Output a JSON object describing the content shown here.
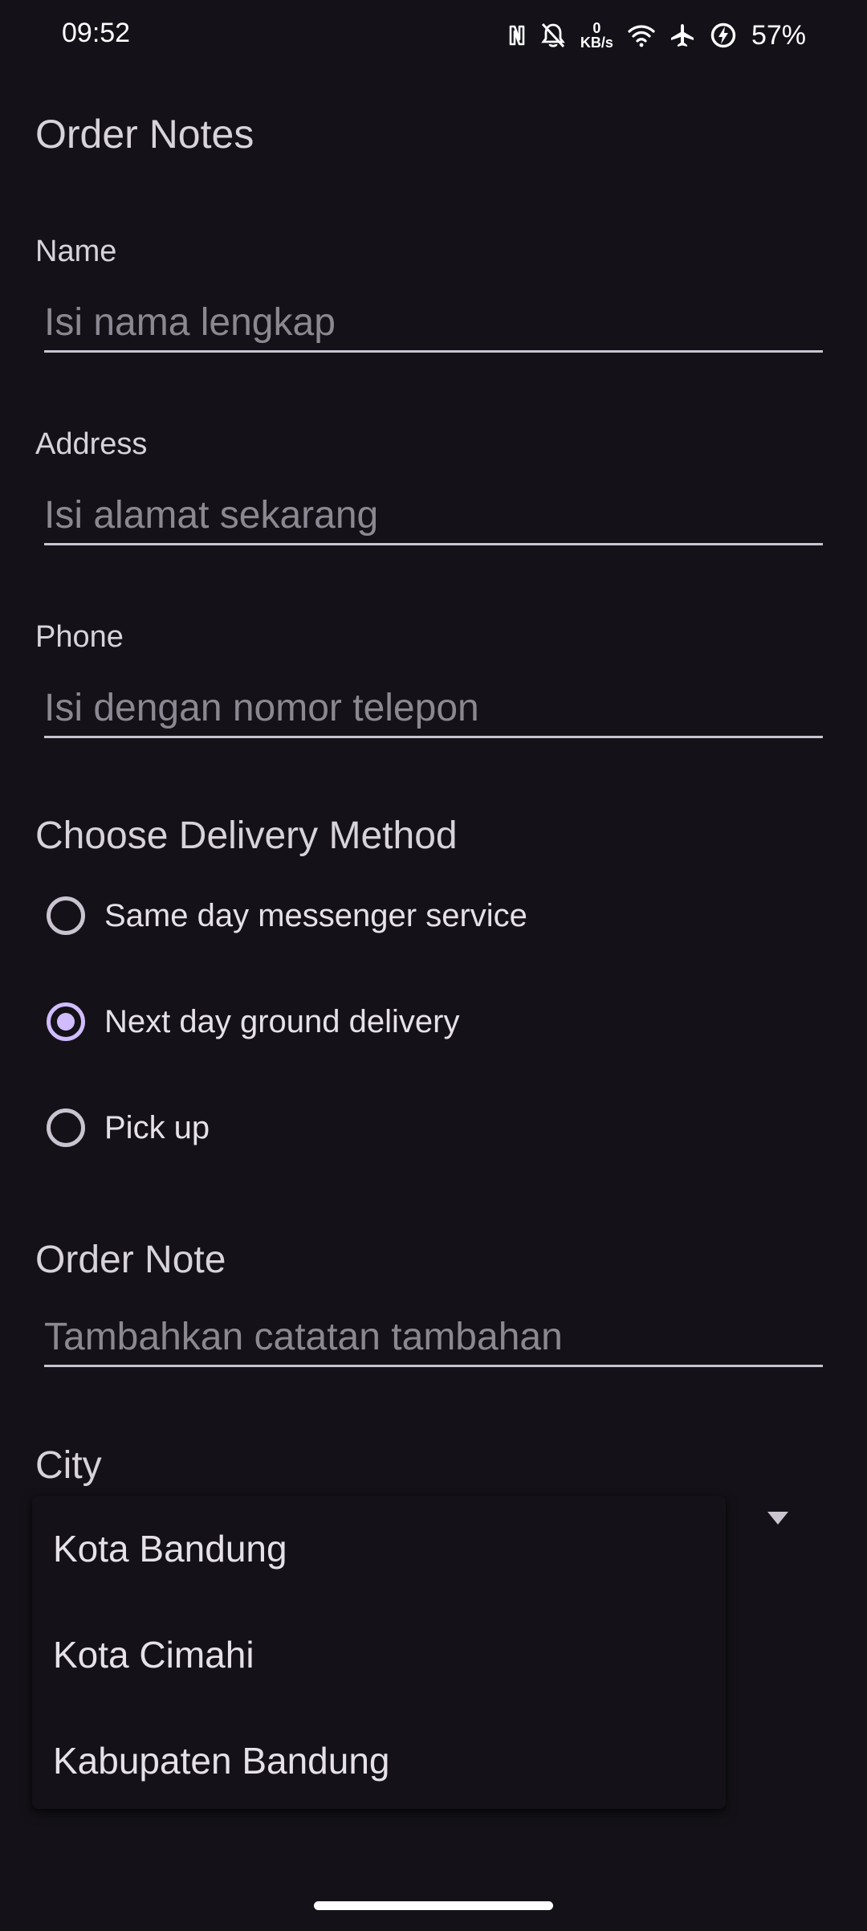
{
  "status_bar": {
    "time": "09:52",
    "net_speed_value": "0",
    "net_speed_unit": "KB/s",
    "battery": "57%",
    "icons": [
      "nfc-icon",
      "bell-off-icon",
      "wifi-icon",
      "airplane-icon",
      "battery-saver-icon"
    ]
  },
  "page": {
    "title": "Order Notes"
  },
  "form": {
    "name": {
      "label": "Name",
      "placeholder": "Isi nama lengkap",
      "value": ""
    },
    "address": {
      "label": "Address",
      "placeholder": "Isi alamat sekarang",
      "value": ""
    },
    "phone": {
      "label": "Phone",
      "placeholder": "Isi dengan nomor telepon",
      "value": ""
    }
  },
  "delivery": {
    "title": "Choose Delivery Method",
    "options": [
      {
        "label": "Same day messenger service",
        "selected": false
      },
      {
        "label": "Next day ground delivery",
        "selected": true
      },
      {
        "label": "Pick up",
        "selected": false
      }
    ]
  },
  "order_note": {
    "title": "Order Note",
    "placeholder": "Tambahkan catatan tambahan",
    "value": ""
  },
  "city": {
    "title": "City",
    "options": [
      "Kota Bandung",
      "Kota Cimahi",
      "Kabupaten Bandung"
    ]
  },
  "colors": {
    "background": "#141218",
    "accent": "#D0BCFF",
    "text": "#E6E0E9"
  }
}
